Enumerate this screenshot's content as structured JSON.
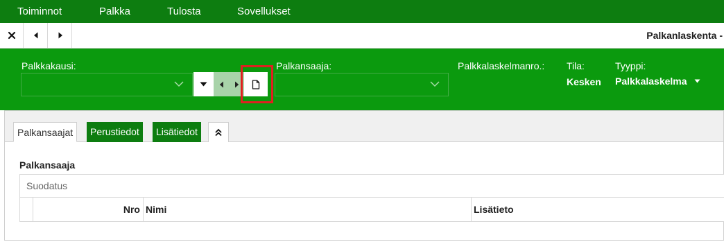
{
  "menu": {
    "items": [
      "Toiminnot",
      "Palkka",
      "Tulosta",
      "Sovellukset"
    ]
  },
  "window": {
    "title": "Palkanlaskenta -"
  },
  "header": {
    "palkkakausi_label": "Palkkakausi:",
    "palkkakausi_value": "",
    "palkansaaja_label": "Palkansaaja:",
    "palkansaaja_value": "",
    "palkkalaskelmanro_label": "Palkkalaskelmanro.:",
    "tila_label": "Tila:",
    "tila_value": "Kesken",
    "tyyppi_label": "Tyyppi:",
    "tyyppi_value": "Palkkalaskelma"
  },
  "tabs": {
    "items": [
      "Palkansaajat",
      "Perustiedot",
      "Lisätiedot"
    ],
    "active": "Palkansaajat"
  },
  "section": {
    "title": "Palkansaaja",
    "filter_placeholder": "Suodatus",
    "columns": [
      "Nro",
      "Nimi",
      "Lisätieto"
    ]
  },
  "colors": {
    "menubar": "#0d7d10",
    "header": "#0b9a0e",
    "highlight": "#e02020"
  },
  "icons": {
    "close": "close-icon",
    "prev": "caret-left-icon",
    "next": "caret-right-icon",
    "new_document": "new-document-icon",
    "dropdown": "caret-down-icon",
    "collapse": "double-chevron-up-icon"
  }
}
